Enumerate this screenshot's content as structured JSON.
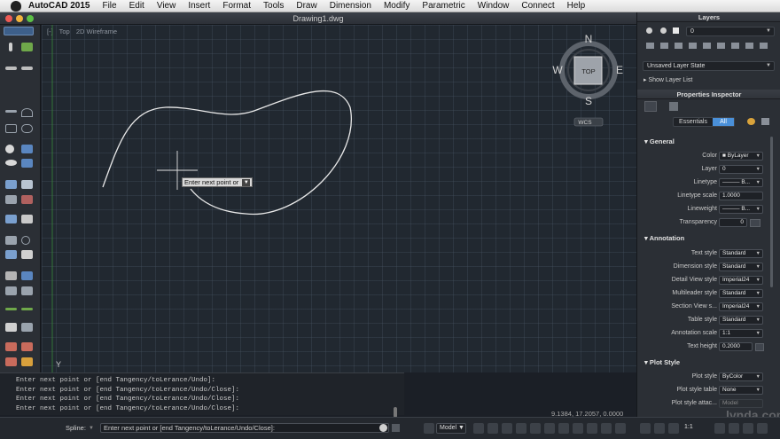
{
  "menubar": {
    "app": "AutoCAD 2015",
    "items": [
      "File",
      "Edit",
      "View",
      "Insert",
      "Format",
      "Tools",
      "Draw",
      "Dimension",
      "Modify",
      "Parametric",
      "Window",
      "Connect",
      "Help"
    ]
  },
  "window": {
    "title": "Drawing1.dwg"
  },
  "viewport": {
    "view_label": "Top",
    "visual_style": "2D Wireframe",
    "prefix": "[-]"
  },
  "viewcube": {
    "north": "N",
    "south": "S",
    "east": "E",
    "west": "W",
    "face": "TOP",
    "wcs": "WCS"
  },
  "tooltip": {
    "text": "Enter next point or"
  },
  "layers": {
    "title": "Layers",
    "current_layer": "0",
    "layer_state": "Unsaved Layer State",
    "show_list": "Show Layer List"
  },
  "properties": {
    "title": "Properties Inspector",
    "tabs": [
      "Essentials",
      "All"
    ],
    "general": {
      "title": "General",
      "rows": [
        {
          "label": "Color",
          "value": "ByLayer"
        },
        {
          "label": "Layer",
          "value": "0"
        },
        {
          "label": "Linetype",
          "value": "B..."
        },
        {
          "label": "Linetype scale",
          "value": "1.0000"
        },
        {
          "label": "Lineweight",
          "value": "B..."
        },
        {
          "label": "Transparency",
          "value": "0"
        }
      ]
    },
    "annotation": {
      "title": "Annotation",
      "rows": [
        {
          "label": "Text style",
          "value": "Standard"
        },
        {
          "label": "Dimension style",
          "value": "Standard"
        },
        {
          "label": "Detail View style",
          "value": "Imperial24"
        },
        {
          "label": "Multileader style",
          "value": "Standard"
        },
        {
          "label": "Section View s...",
          "value": "Imperial24"
        },
        {
          "label": "Table style",
          "value": "Standard"
        },
        {
          "label": "Annotation scale",
          "value": "1:1"
        },
        {
          "label": "Text height",
          "value": "0.2000"
        }
      ]
    },
    "plotstyle": {
      "title": "Plot Style",
      "rows": [
        {
          "label": "Plot style",
          "value": "ByColor"
        },
        {
          "label": "Plot style table",
          "value": "None"
        },
        {
          "label": "Plot style attac...",
          "value": "Model"
        }
      ]
    }
  },
  "command": {
    "history": [
      "Enter next point or [end Tangency/toLerance/Undo]:",
      "Enter next point or [end Tangency/toLerance/Undo/Close]:",
      "Enter next point or [end Tangency/toLerance/Undo/Close]:",
      "Enter next point or [end Tangency/toLerance/Undo/Close]:"
    ],
    "prompt": "Spline:",
    "input": "Enter next point or [end Tangency/toLerance/Undo/Close]:"
  },
  "status": {
    "coords": "9.1384, 17.2057, 0.0000",
    "model": "Model",
    "scale": "1:1",
    "watermark": "lynda.com"
  },
  "colors": {
    "accent": "#4a90d9",
    "canvas": "#212830",
    "panel": "#2b2f35"
  }
}
